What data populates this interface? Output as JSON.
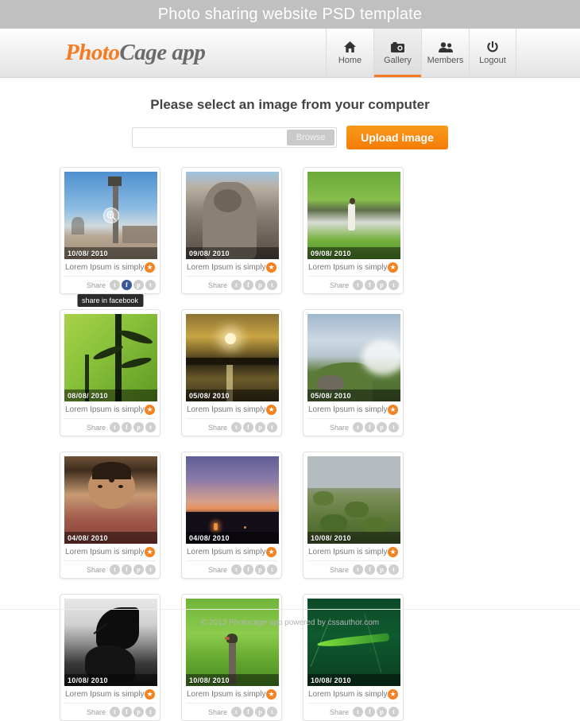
{
  "banner": {
    "title": "Photo sharing website PSD template"
  },
  "header": {
    "logo_part1": "Photo",
    "logo_part2": "Cage app",
    "nav": [
      {
        "label": "Home",
        "icon": "home-icon",
        "active": false
      },
      {
        "label": "Gallery",
        "icon": "camera-icon",
        "active": true
      },
      {
        "label": "Members",
        "icon": "people-icon",
        "active": false
      },
      {
        "label": "Logout",
        "icon": "power-icon",
        "active": false
      }
    ]
  },
  "upload": {
    "title": "Please select an image from your computer",
    "file_value": "",
    "file_placeholder": "",
    "browse_label": "Browse",
    "submit_label": "Upload image"
  },
  "gallery": {
    "share_label": "Share",
    "caption_text": "Lorem Ipsum is simply",
    "tooltip_text": "share in facebook",
    "social_icons": [
      "twitter-icon",
      "facebook-icon",
      "pinterest-icon",
      "tumblr-icon"
    ],
    "social_glyphs": [
      "t",
      "f",
      "p",
      "t"
    ],
    "items": [
      {
        "date": "10/08/ 2010",
        "alt": "stone-pillar-monument-blue-sky",
        "hover": true,
        "active_share": 1
      },
      {
        "date": "09/08/ 2010",
        "alt": "stone-statue-sculpture",
        "hover": false,
        "active_share": -1
      },
      {
        "date": "09/08/ 2010",
        "alt": "woman-walking-in-paddy-field",
        "hover": false,
        "active_share": -1
      },
      {
        "date": "08/08/ 2010",
        "alt": "bamboo-plant-on-green",
        "hover": false,
        "active_share": -1
      },
      {
        "date": "05/08/ 2010",
        "alt": "golden-sunset-over-lake",
        "hover": false,
        "active_share": -1
      },
      {
        "date": "05/08/ 2010",
        "alt": "green-hills-with-clouds",
        "hover": false,
        "active_share": -1
      },
      {
        "date": "04/08/ 2010",
        "alt": "portrait-of-young-girl",
        "hover": false,
        "active_share": -1
      },
      {
        "date": "04/08/ 2010",
        "alt": "city-skyline-at-dusk",
        "hover": false,
        "active_share": -1
      },
      {
        "date": "10/08/ 2010",
        "alt": "mossy-rocks-by-water",
        "hover": false,
        "active_share": -1
      },
      {
        "date": "10/08/ 2010",
        "alt": "butterfly-black-and-white",
        "hover": false,
        "active_share": -1
      },
      {
        "date": "10/08/ 2010",
        "alt": "bird-on-post-in-grass",
        "hover": false,
        "active_share": -1
      },
      {
        "date": "10/08/ 2010",
        "alt": "green-leaf-on-dark-background",
        "hover": false,
        "active_share": -1
      }
    ]
  },
  "footer": {
    "text": "© 2013 Photocage app  powered by cssauthor.com"
  },
  "colors": {
    "accent": "#f47b20",
    "banner_bg": "#c0c0c0",
    "facebook": "#3b5998",
    "social_gray": "#cfcfcf"
  }
}
